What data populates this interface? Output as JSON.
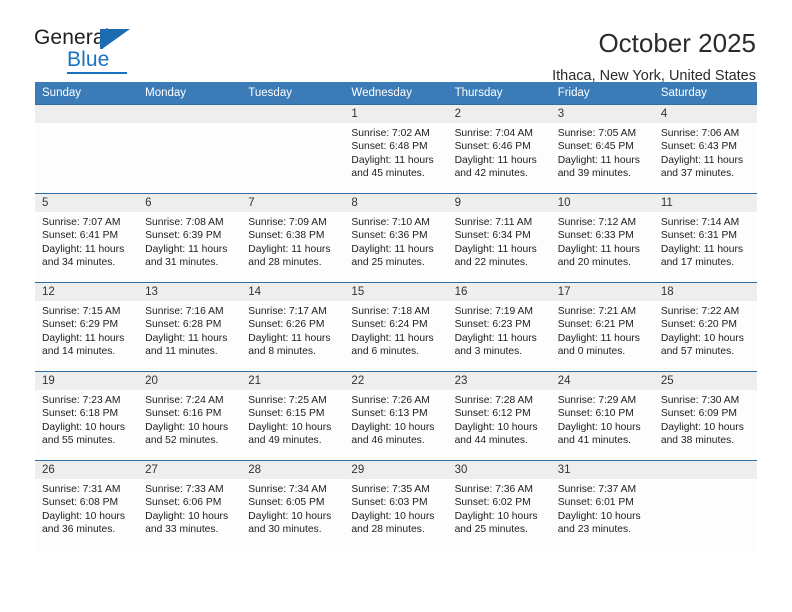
{
  "brand": {
    "name_part1": "General",
    "name_part2": "Blue",
    "logo_icon": "triangle-flag-icon"
  },
  "header": {
    "title": "October 2025",
    "subtitle": "Ithaca, New York, United States"
  },
  "colors": {
    "header_blue": "#3b7cb8",
    "row_border_blue": "#2e6da4",
    "daynum_band": "#eeeeee",
    "brand_blue": "#1673c4"
  },
  "weekdays": [
    "Sunday",
    "Monday",
    "Tuesday",
    "Wednesday",
    "Thursday",
    "Friday",
    "Saturday"
  ],
  "labels": {
    "sunrise_prefix": "Sunrise:",
    "sunset_prefix": "Sunset:",
    "daylight_prefix": "Daylight:"
  },
  "weeks": [
    [
      {
        "day": "",
        "blank": true
      },
      {
        "day": "",
        "blank": true
      },
      {
        "day": "",
        "blank": true
      },
      {
        "day": "1",
        "sunrise": "Sunrise: 7:02 AM",
        "sunset": "Sunset: 6:48 PM",
        "daylight1": "Daylight: 11 hours",
        "daylight2": "and 45 minutes."
      },
      {
        "day": "2",
        "sunrise": "Sunrise: 7:04 AM",
        "sunset": "Sunset: 6:46 PM",
        "daylight1": "Daylight: 11 hours",
        "daylight2": "and 42 minutes."
      },
      {
        "day": "3",
        "sunrise": "Sunrise: 7:05 AM",
        "sunset": "Sunset: 6:45 PM",
        "daylight1": "Daylight: 11 hours",
        "daylight2": "and 39 minutes."
      },
      {
        "day": "4",
        "sunrise": "Sunrise: 7:06 AM",
        "sunset": "Sunset: 6:43 PM",
        "daylight1": "Daylight: 11 hours",
        "daylight2": "and 37 minutes."
      }
    ],
    [
      {
        "day": "5",
        "sunrise": "Sunrise: 7:07 AM",
        "sunset": "Sunset: 6:41 PM",
        "daylight1": "Daylight: 11 hours",
        "daylight2": "and 34 minutes."
      },
      {
        "day": "6",
        "sunrise": "Sunrise: 7:08 AM",
        "sunset": "Sunset: 6:39 PM",
        "daylight1": "Daylight: 11 hours",
        "daylight2": "and 31 minutes."
      },
      {
        "day": "7",
        "sunrise": "Sunrise: 7:09 AM",
        "sunset": "Sunset: 6:38 PM",
        "daylight1": "Daylight: 11 hours",
        "daylight2": "and 28 minutes."
      },
      {
        "day": "8",
        "sunrise": "Sunrise: 7:10 AM",
        "sunset": "Sunset: 6:36 PM",
        "daylight1": "Daylight: 11 hours",
        "daylight2": "and 25 minutes."
      },
      {
        "day": "9",
        "sunrise": "Sunrise: 7:11 AM",
        "sunset": "Sunset: 6:34 PM",
        "daylight1": "Daylight: 11 hours",
        "daylight2": "and 22 minutes."
      },
      {
        "day": "10",
        "sunrise": "Sunrise: 7:12 AM",
        "sunset": "Sunset: 6:33 PM",
        "daylight1": "Daylight: 11 hours",
        "daylight2": "and 20 minutes."
      },
      {
        "day": "11",
        "sunrise": "Sunrise: 7:14 AM",
        "sunset": "Sunset: 6:31 PM",
        "daylight1": "Daylight: 11 hours",
        "daylight2": "and 17 minutes."
      }
    ],
    [
      {
        "day": "12",
        "sunrise": "Sunrise: 7:15 AM",
        "sunset": "Sunset: 6:29 PM",
        "daylight1": "Daylight: 11 hours",
        "daylight2": "and 14 minutes."
      },
      {
        "day": "13",
        "sunrise": "Sunrise: 7:16 AM",
        "sunset": "Sunset: 6:28 PM",
        "daylight1": "Daylight: 11 hours",
        "daylight2": "and 11 minutes."
      },
      {
        "day": "14",
        "sunrise": "Sunrise: 7:17 AM",
        "sunset": "Sunset: 6:26 PM",
        "daylight1": "Daylight: 11 hours",
        "daylight2": "and 8 minutes."
      },
      {
        "day": "15",
        "sunrise": "Sunrise: 7:18 AM",
        "sunset": "Sunset: 6:24 PM",
        "daylight1": "Daylight: 11 hours",
        "daylight2": "and 6 minutes."
      },
      {
        "day": "16",
        "sunrise": "Sunrise: 7:19 AM",
        "sunset": "Sunset: 6:23 PM",
        "daylight1": "Daylight: 11 hours",
        "daylight2": "and 3 minutes."
      },
      {
        "day": "17",
        "sunrise": "Sunrise: 7:21 AM",
        "sunset": "Sunset: 6:21 PM",
        "daylight1": "Daylight: 11 hours",
        "daylight2": "and 0 minutes."
      },
      {
        "day": "18",
        "sunrise": "Sunrise: 7:22 AM",
        "sunset": "Sunset: 6:20 PM",
        "daylight1": "Daylight: 10 hours",
        "daylight2": "and 57 minutes."
      }
    ],
    [
      {
        "day": "19",
        "sunrise": "Sunrise: 7:23 AM",
        "sunset": "Sunset: 6:18 PM",
        "daylight1": "Daylight: 10 hours",
        "daylight2": "and 55 minutes."
      },
      {
        "day": "20",
        "sunrise": "Sunrise: 7:24 AM",
        "sunset": "Sunset: 6:16 PM",
        "daylight1": "Daylight: 10 hours",
        "daylight2": "and 52 minutes."
      },
      {
        "day": "21",
        "sunrise": "Sunrise: 7:25 AM",
        "sunset": "Sunset: 6:15 PM",
        "daylight1": "Daylight: 10 hours",
        "daylight2": "and 49 minutes."
      },
      {
        "day": "22",
        "sunrise": "Sunrise: 7:26 AM",
        "sunset": "Sunset: 6:13 PM",
        "daylight1": "Daylight: 10 hours",
        "daylight2": "and 46 minutes."
      },
      {
        "day": "23",
        "sunrise": "Sunrise: 7:28 AM",
        "sunset": "Sunset: 6:12 PM",
        "daylight1": "Daylight: 10 hours",
        "daylight2": "and 44 minutes."
      },
      {
        "day": "24",
        "sunrise": "Sunrise: 7:29 AM",
        "sunset": "Sunset: 6:10 PM",
        "daylight1": "Daylight: 10 hours",
        "daylight2": "and 41 minutes."
      },
      {
        "day": "25",
        "sunrise": "Sunrise: 7:30 AM",
        "sunset": "Sunset: 6:09 PM",
        "daylight1": "Daylight: 10 hours",
        "daylight2": "and 38 minutes."
      }
    ],
    [
      {
        "day": "26",
        "sunrise": "Sunrise: 7:31 AM",
        "sunset": "Sunset: 6:08 PM",
        "daylight1": "Daylight: 10 hours",
        "daylight2": "and 36 minutes."
      },
      {
        "day": "27",
        "sunrise": "Sunrise: 7:33 AM",
        "sunset": "Sunset: 6:06 PM",
        "daylight1": "Daylight: 10 hours",
        "daylight2": "and 33 minutes."
      },
      {
        "day": "28",
        "sunrise": "Sunrise: 7:34 AM",
        "sunset": "Sunset: 6:05 PM",
        "daylight1": "Daylight: 10 hours",
        "daylight2": "and 30 minutes."
      },
      {
        "day": "29",
        "sunrise": "Sunrise: 7:35 AM",
        "sunset": "Sunset: 6:03 PM",
        "daylight1": "Daylight: 10 hours",
        "daylight2": "and 28 minutes."
      },
      {
        "day": "30",
        "sunrise": "Sunrise: 7:36 AM",
        "sunset": "Sunset: 6:02 PM",
        "daylight1": "Daylight: 10 hours",
        "daylight2": "and 25 minutes."
      },
      {
        "day": "31",
        "sunrise": "Sunrise: 7:37 AM",
        "sunset": "Sunset: 6:01 PM",
        "daylight1": "Daylight: 10 hours",
        "daylight2": "and 23 minutes."
      },
      {
        "day": "",
        "blank": true
      }
    ]
  ]
}
